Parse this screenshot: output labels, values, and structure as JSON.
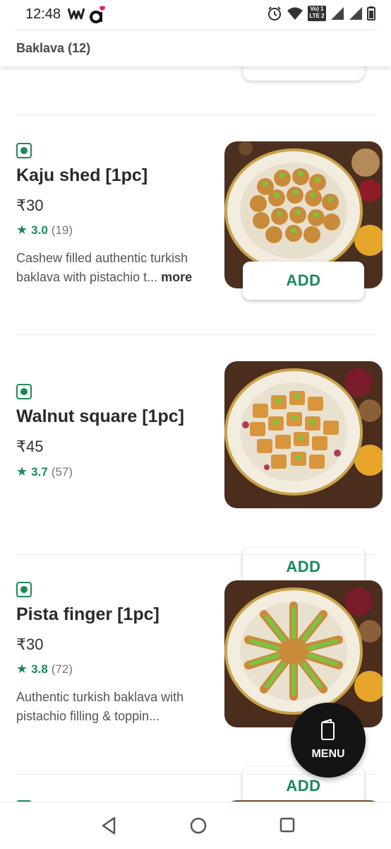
{
  "status_bar": {
    "time": "12:48",
    "left_icons": [
      "w-logo-icon",
      "a-logo-icon"
    ],
    "right_icons": [
      "alarm-icon",
      "wifi-icon",
      "volte-icon",
      "signal-icon",
      "signal-icon",
      "battery-icon"
    ],
    "volte_label_top": "Vo) 1",
    "volte_label_bottom": "LTE 2"
  },
  "header": {
    "title": "Baklava (12)"
  },
  "items": [
    {
      "name": "Kaju shed [1pc]",
      "price": "₹30",
      "rating": "3.0",
      "rating_count": "(19)",
      "description": "Cashew filled authentic turkish baklava with pistachio t...",
      "more_label": "more",
      "add_label": "ADD",
      "image_icon": "baklava-plate-image"
    },
    {
      "name": "Walnut square [1pc]",
      "price": "₹45",
      "rating": "3.7",
      "rating_count": "(57)",
      "description": "",
      "more_label": "",
      "add_label": "ADD",
      "image_icon": "baklava-plate-image"
    },
    {
      "name": "Pista finger [1pc]",
      "price": "₹30",
      "rating": "3.8",
      "rating_count": "(72)",
      "description": "Authentic turkish baklava with pistachio filling & toppin...",
      "more_label": "",
      "add_label": "ADD",
      "image_icon": "baklava-plate-image"
    }
  ],
  "menu_fab": {
    "label": "MENU",
    "icon": "menu-book-icon"
  },
  "nav_bar": {
    "buttons": [
      "back-icon",
      "home-icon",
      "recents-icon"
    ]
  },
  "colors": {
    "accent_green": "#1b8a5a",
    "fab_black": "#141414"
  }
}
